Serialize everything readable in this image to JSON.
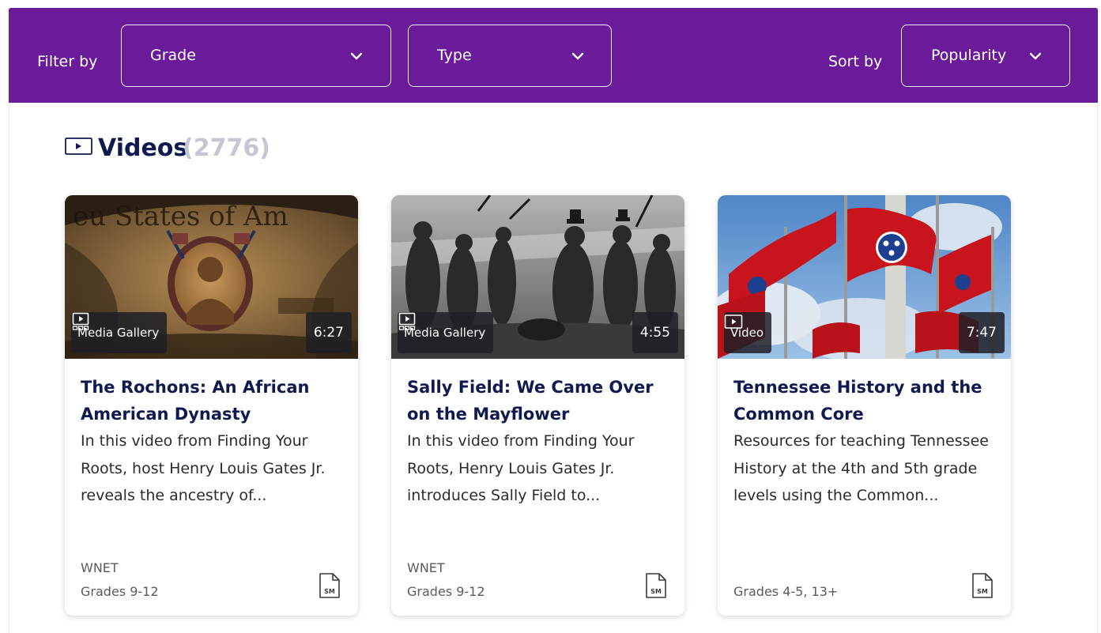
{
  "filters": {
    "filter_label": "Filter by",
    "grade_value": "Grade",
    "type_value": "Type",
    "sort_label": "Sort by",
    "sort_value": "Popularity"
  },
  "section": {
    "title": "Videos",
    "count": "(2776)",
    "icon": "video-play-icon"
  },
  "cards": [
    {
      "type": "Media Gallery",
      "type_icon": "media-gallery-icon",
      "duration": "6:27",
      "title": "The Rochons: An African American Dynasty",
      "description": "In this video from Finding Your Roots, host Henry Louis Gates Jr. reveals the ancestry of...",
      "source": "WNET",
      "grades": "Grades 9-12",
      "file_icon": "document-sm-icon",
      "file_icon_text": "SM"
    },
    {
      "type": "Media Gallery",
      "type_icon": "media-gallery-icon",
      "duration": "4:55",
      "title": "Sally Field: We Came Over on the Mayflower",
      "description": "In this video from Finding Your Roots, Henry Louis Gates Jr. introduces Sally Field to...",
      "source": "WNET",
      "grades": "Grades 9-12",
      "file_icon": "document-sm-icon",
      "file_icon_text": "SM"
    },
    {
      "type": "Video",
      "type_icon": "video-play-icon",
      "duration": "7:47",
      "title": "Tennessee History and the Common Core",
      "description": "Resources for teaching Tennessee History at the 4th and 5th grade levels using the Common...",
      "source": "",
      "grades": "Grades 4-5, 13+",
      "file_icon": "document-sm-icon",
      "file_icon_text": "SM"
    }
  ],
  "colors": {
    "filter_bar": "#6a1b9a",
    "heading": "#0f1a4f",
    "count": "#c4c6d4"
  }
}
